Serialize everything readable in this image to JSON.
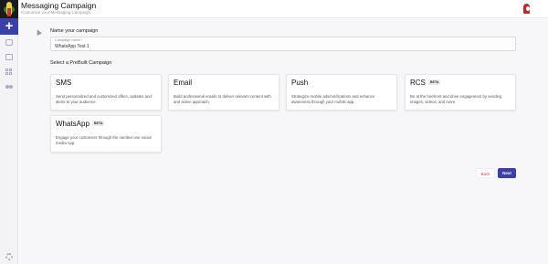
{
  "header": {
    "title": "Messaging Campaign",
    "subtitle": "Customize your Messaging Campaign"
  },
  "sidebar": {
    "add_label": "+",
    "items": [
      {
        "icon": "campaign-icon"
      },
      {
        "icon": "clipboard-icon"
      },
      {
        "icon": "grid-icon"
      },
      {
        "icon": "users-icon"
      }
    ],
    "settings_icon": "gear-icon"
  },
  "form": {
    "name_label": "Name your campaign",
    "field_label": "Campaign name *",
    "field_value": "WhatsApp Test 1",
    "prebuilt_label": "Select a PreBuilt Campaign"
  },
  "campaigns": [
    {
      "title": "SMS",
      "beta": "",
      "description": "Send personalized and customized offers, updates and alerts to your audience."
    },
    {
      "title": "Email",
      "beta": "",
      "description": "Build professional emails to deliver relevant content with and active approach."
    },
    {
      "title": "Push",
      "beta": "",
      "description": "Strategize mobile ads/notifications and enhance awareness through your mobile app."
    },
    {
      "title": "RCS",
      "beta": "BETA",
      "description": "Be at the forefront and drive engagement by sending images, videos, and more."
    },
    {
      "title": "WhatsApp",
      "beta": "BETA",
      "description": "Engage your customers through the number one social media App."
    }
  ],
  "actions": {
    "back": "Back",
    "next": "Next"
  },
  "colors": {
    "primary": "#3b3fa8",
    "back_text": "#d04545"
  }
}
